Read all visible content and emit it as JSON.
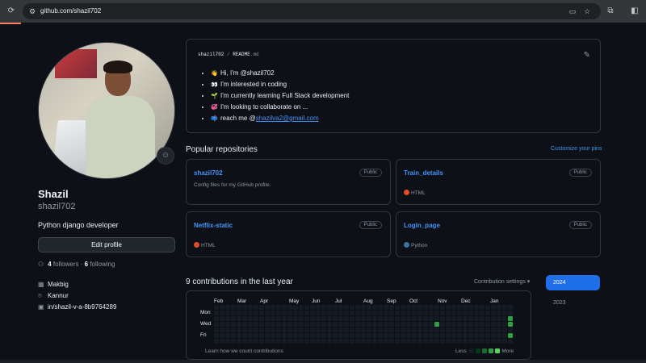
{
  "browser": {
    "url": "github.com/shazil702",
    "icons": [
      "reload-icon",
      "site-info-icon",
      "cast-icon",
      "bookmark-star-icon",
      "extensions-icon",
      "side-panel-icon"
    ]
  },
  "profile": {
    "name": "Shazil",
    "login": "shazil702",
    "bio": "Python django developer",
    "edit_label": "Edit profile",
    "followers_count": "4",
    "followers_label": "followers",
    "separator": "·",
    "following_count": "6",
    "following_label": "following",
    "company": "Makbig",
    "location": "Kannur",
    "linkedin": "in/shazil-v-a-8b9764289"
  },
  "readme": {
    "owner": "shazil702",
    "separator": "/",
    "file": "README",
    "ext": ".md",
    "items": [
      {
        "emoji": "👋",
        "text": "Hi, I'm @shazil702"
      },
      {
        "emoji": "👀",
        "text": "I'm interested in coding"
      },
      {
        "emoji": "🌱",
        "text": "I'm currently learning Full Stack development"
      },
      {
        "emoji": "💞️",
        "text": "I'm looking to collaborate on ..."
      },
      {
        "emoji": "📫",
        "text": "reach me @",
        "link": "shazilva2@gmail.com"
      }
    ]
  },
  "popular": {
    "title": "Popular repositories",
    "customize": "Customize your pins",
    "repos": [
      {
        "name": "shazil702",
        "badge": "Public",
        "desc": "Config files for my GitHub profile.",
        "lang": "",
        "color": ""
      },
      {
        "name": "Train_details",
        "badge": "Public",
        "desc": "",
        "lang": "HTML",
        "color": "#e34c26"
      },
      {
        "name": "Netflix-static",
        "badge": "Public",
        "desc": "",
        "lang": "HTML",
        "color": "#e34c26"
      },
      {
        "name": "Login_page",
        "badge": "Public",
        "desc": "",
        "lang": "Python",
        "color": "#3572A5"
      }
    ]
  },
  "contributions": {
    "title": "9 contributions in the last year",
    "settings": "Contribution settings ▾",
    "months": [
      "Feb",
      "Mar",
      "Apr",
      "May",
      "Jun",
      "Jul",
      "Aug",
      "Sep",
      "Oct",
      "Nov",
      "Dec",
      "Jan"
    ],
    "days": [
      "Mon",
      "Wed",
      "Fri"
    ],
    "learn": "Learn how we count contributions",
    "less": "Less",
    "more": "More",
    "weeks": 53,
    "active_cells": [
      {
        "week": 39,
        "day": 3,
        "level": 3
      },
      {
        "week": 52,
        "day": 2,
        "level": 3
      },
      {
        "week": 52,
        "day": 3,
        "level": 3
      },
      {
        "week": 52,
        "day": 5,
        "level": 3
      }
    ],
    "colors": {
      "empty": "#151b23",
      "l1": "#033a16",
      "l2": "#196c2e",
      "l3": "#2ea043",
      "l4": "#56d364"
    },
    "years": [
      "2024",
      "2023"
    ],
    "active_year": "2024"
  }
}
